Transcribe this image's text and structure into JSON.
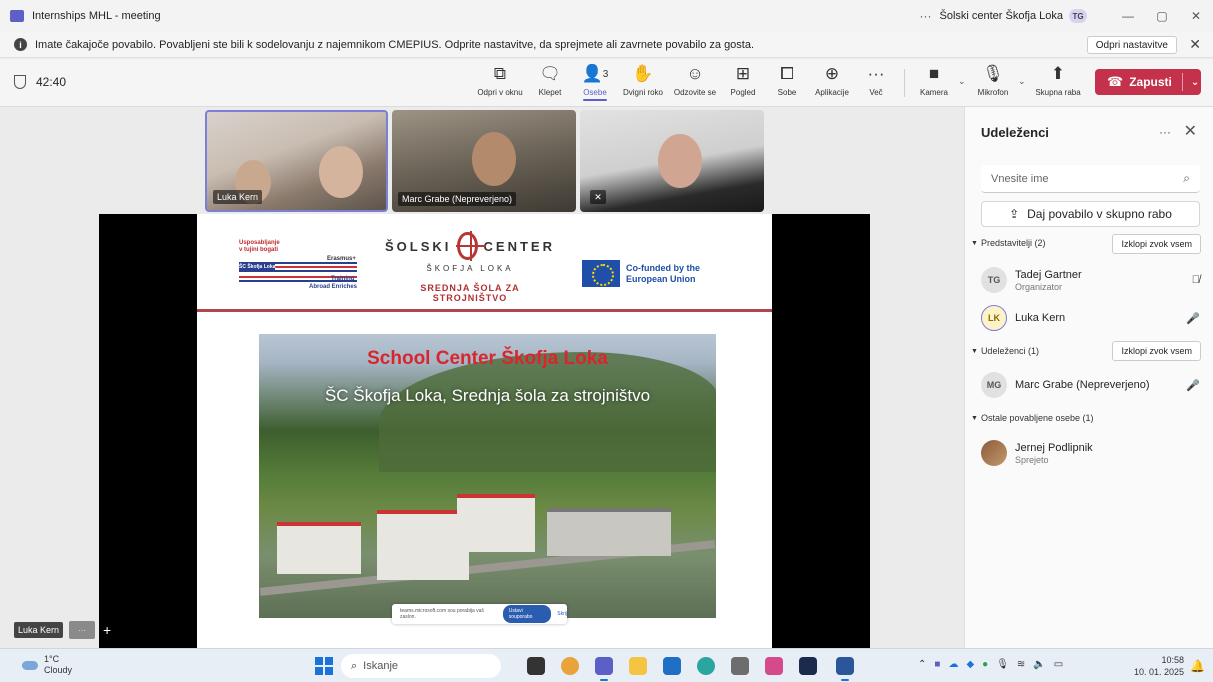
{
  "window": {
    "title": "Internships MHL - meeting",
    "org_name": "Šolski center Škofja Loka",
    "user_initials": "TG",
    "more": "···"
  },
  "notice": {
    "text": "Imate čakajoče povabilo. Povabljeni ste bili k sodelovanju z najemnikom CMEPIUS. Odprite nastavitve, da sprejmete ali zavrnete povabilo za gosta.",
    "open_settings": "Odpri nastavitve"
  },
  "toolbar": {
    "timer": "42:40",
    "items": [
      {
        "label": "Odpri v oknu",
        "icon": "popout-icon"
      },
      {
        "label": "Klepet",
        "icon": "chat-icon"
      },
      {
        "label": "Osebe",
        "icon": "people-icon",
        "badge": "3"
      },
      {
        "label": "Dvigni roko",
        "icon": "raise-hand-icon"
      },
      {
        "label": "Odzovite se",
        "icon": "react-icon"
      },
      {
        "label": "Pogled",
        "icon": "view-icon"
      },
      {
        "label": "Sobe",
        "icon": "rooms-icon"
      },
      {
        "label": "Aplikacije",
        "icon": "apps-icon"
      },
      {
        "label": "Več",
        "icon": "more-icon"
      }
    ],
    "camera": "Kamera",
    "mic": "Mikrofon",
    "share": "Skupna raba",
    "leave": "Zapusti"
  },
  "participants_tiles": [
    {
      "name": "Luka Kern"
    },
    {
      "name": "Marc Grabe (Nepreverjeno)"
    },
    {
      "name": ""
    }
  ],
  "slide": {
    "logo_left": {
      "line1": "Usposabljanje",
      "line2": "v tujini bogati",
      "erasmus": "Erasmus+",
      "school": "ŠC Škofja Loka",
      "training": "Training",
      "abroad": "Abroad Enriches"
    },
    "school_logo": {
      "left": "ŠOLSKI",
      "right": "CENTER",
      "city": "ŠKOFJA LOKA",
      "subtitle": "SREDNJA ŠOLA ZA STROJNIŠTVO"
    },
    "eu_text": "Co-funded by the European Union",
    "photo_title": "School Center Škofja Loka",
    "photo_subtitle": "ŠC Škofja Loka, Srednja šola za strojništvo",
    "caption_text": "teams.microsoft.com sou porabija vaš zaslon.",
    "caption_button": "Ustavi souporabo",
    "caption_skip": "Skrij"
  },
  "self_view": {
    "name": "Luka Kern",
    "more": "···"
  },
  "panel": {
    "title": "Udeleženci",
    "more": "···",
    "search_placeholder": "Vnesite ime",
    "share_invite": "Daj povabilo v skupno rabo",
    "sections": [
      {
        "title": "Predstavitelji (2)",
        "action": "Izklopi zvok vsem",
        "people": [
          {
            "initials": "TG",
            "name": "Tadej Gartner",
            "role": "Organizator",
            "mic": "muted"
          },
          {
            "initials": "LK",
            "name": "Luka Kern",
            "role": "",
            "mic": "on"
          }
        ]
      },
      {
        "title": "Udeleženci (1)",
        "action": "Izklopi zvok vsem",
        "people": [
          {
            "initials": "MG",
            "name": "Marc Grabe (Nepreverjeno)",
            "role": "",
            "mic": "on"
          }
        ]
      },
      {
        "title": "Ostale povabljene osebe (1)",
        "action": "",
        "people": [
          {
            "initials": "",
            "name": "Jernej Podlipnik",
            "role": "Sprejeto",
            "mic": ""
          }
        ]
      }
    ]
  },
  "taskbar": {
    "temperature": "1°C",
    "weather": "Cloudy",
    "search": "Iskanje",
    "time": "10:58",
    "date": "10. 01. 2025"
  },
  "colors": {
    "accent": "#5b5fc7",
    "leave": "#c4314b"
  }
}
